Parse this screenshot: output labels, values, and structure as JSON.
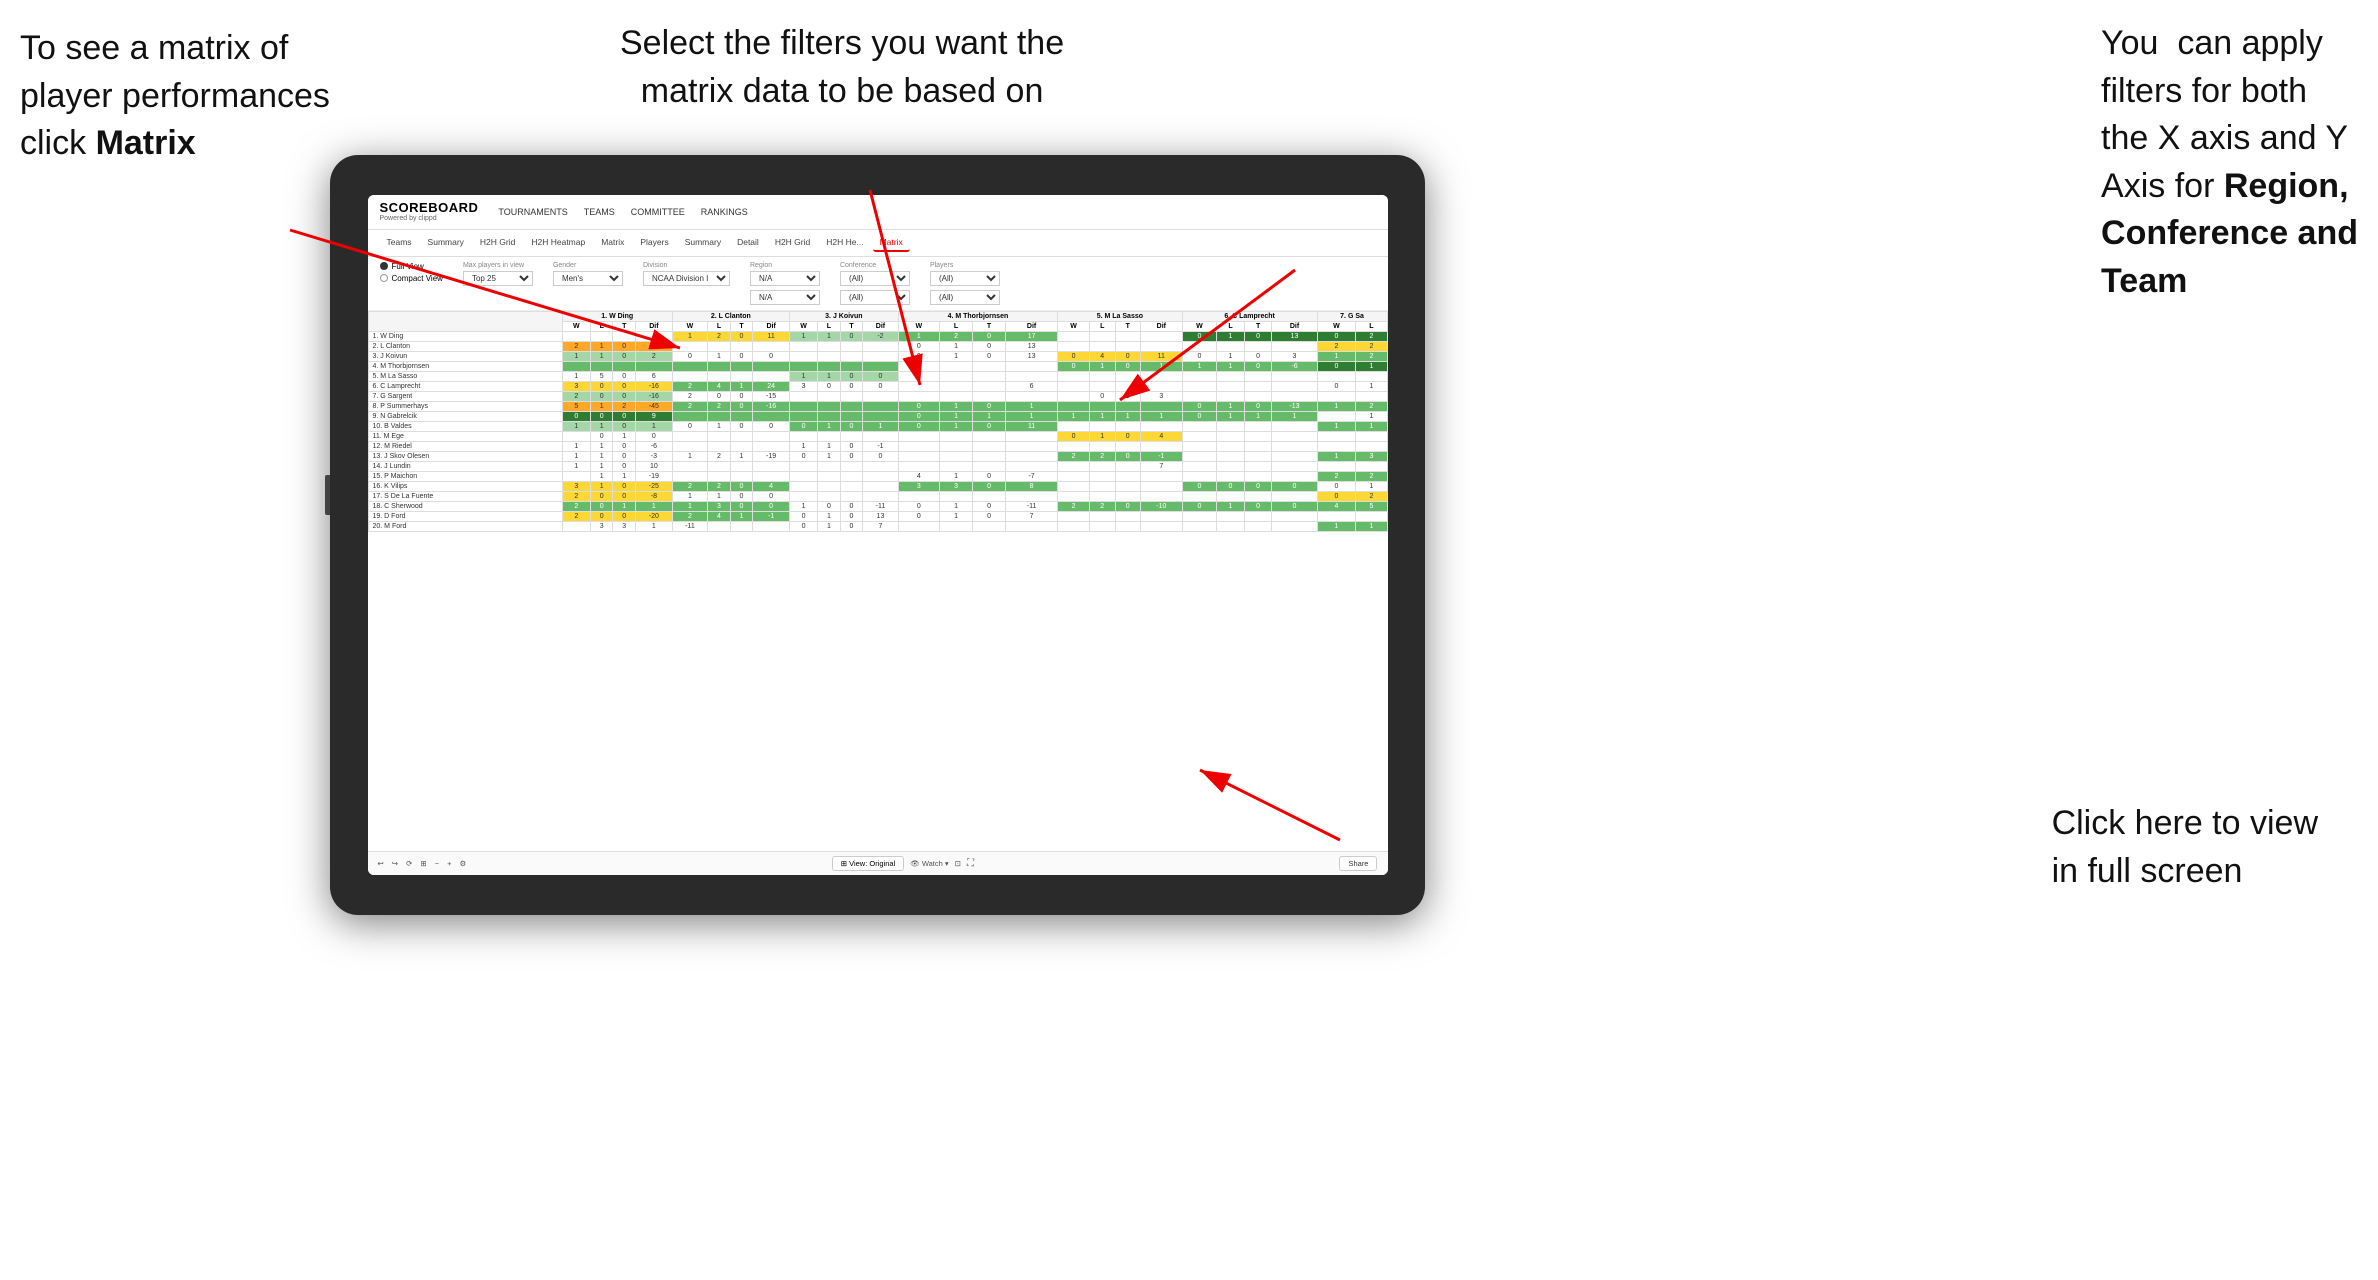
{
  "annotations": {
    "top_left": {
      "line1": "To see a matrix of",
      "line2": "player performances",
      "line3_normal": "click ",
      "line3_bold": "Matrix"
    },
    "top_center": {
      "line1": "Select the filters you want the",
      "line2": "matrix data to be based on"
    },
    "top_right": {
      "line1": "You  can apply",
      "line2": "filters for both",
      "line3": "the X axis and Y",
      "line4_normal": "Axis for ",
      "line4_bold": "Region,",
      "line5_bold": "Conference and",
      "line6_bold": "Team"
    },
    "bottom_right": {
      "line1": "Click here to view",
      "line2": "in full screen"
    }
  },
  "scoreboard": {
    "logo_main": "SCOREBOARD",
    "logo_sub": "Powered by clippd",
    "nav": [
      "TOURNAMENTS",
      "TEAMS",
      "COMMITTEE",
      "RANKINGS"
    ],
    "sub_tabs": [
      "Teams",
      "Summary",
      "H2H Grid",
      "H2H Heatmap",
      "Matrix",
      "Players",
      "Summary",
      "Detail",
      "H2H Grid",
      "H2H He...",
      "Matrix"
    ],
    "active_tab": "Matrix"
  },
  "filters": {
    "view_options": [
      "Full View",
      "Compact View"
    ],
    "selected_view": "Full View",
    "max_players_label": "Max players in view",
    "max_players_value": "Top 25",
    "gender_label": "Gender",
    "gender_value": "Men's",
    "division_label": "Division",
    "division_value": "NCAA Division I",
    "region_label": "Region",
    "region_value1": "N/A",
    "region_value2": "N/A",
    "conference_label": "Conference",
    "conference_value1": "(All)",
    "conference_value2": "(All)",
    "players_label": "Players",
    "players_value1": "(All)",
    "players_value2": "(All)"
  },
  "matrix": {
    "col_headers": [
      "1. W Ding",
      "2. L Clanton",
      "3. J Koivun",
      "4. M Thorbjornsen",
      "5. M La Sasso",
      "6. C Lamprecht",
      "7. G Sa"
    ],
    "sub_headers": [
      "W",
      "L",
      "T",
      "Dif"
    ],
    "rows": [
      {
        "name": "1. W Ding",
        "num": 1
      },
      {
        "name": "2. L Clanton",
        "num": 2
      },
      {
        "name": "3. J Koivun",
        "num": 3
      },
      {
        "name": "4. M Thorbjornsen",
        "num": 4
      },
      {
        "name": "5. M La Sasso",
        "num": 5
      },
      {
        "name": "6. C Lamprecht",
        "num": 6
      },
      {
        "name": "7. G Sargent",
        "num": 7
      },
      {
        "name": "8. P Summerhays",
        "num": 8
      },
      {
        "name": "9. N Gabrelcik",
        "num": 9
      },
      {
        "name": "10. B Valdes",
        "num": 10
      },
      {
        "name": "11. M Ege",
        "num": 11
      },
      {
        "name": "12. M Riedel",
        "num": 12
      },
      {
        "name": "13. J Skov Olesen",
        "num": 13
      },
      {
        "name": "14. J Lundin",
        "num": 14
      },
      {
        "name": "15. P Maichon",
        "num": 15
      },
      {
        "name": "16. K Vilips",
        "num": 16
      },
      {
        "name": "17. S De La Fuente",
        "num": 17
      },
      {
        "name": "18. C Sherwood",
        "num": 18
      },
      {
        "name": "19. D Ford",
        "num": 19
      },
      {
        "name": "20. M Ford",
        "num": 20
      }
    ]
  },
  "toolbar": {
    "view_original": "⊞ View: Original",
    "watch": "👁 Watch ▼",
    "share": "Share",
    "fullscreen_icon": "⛶"
  }
}
